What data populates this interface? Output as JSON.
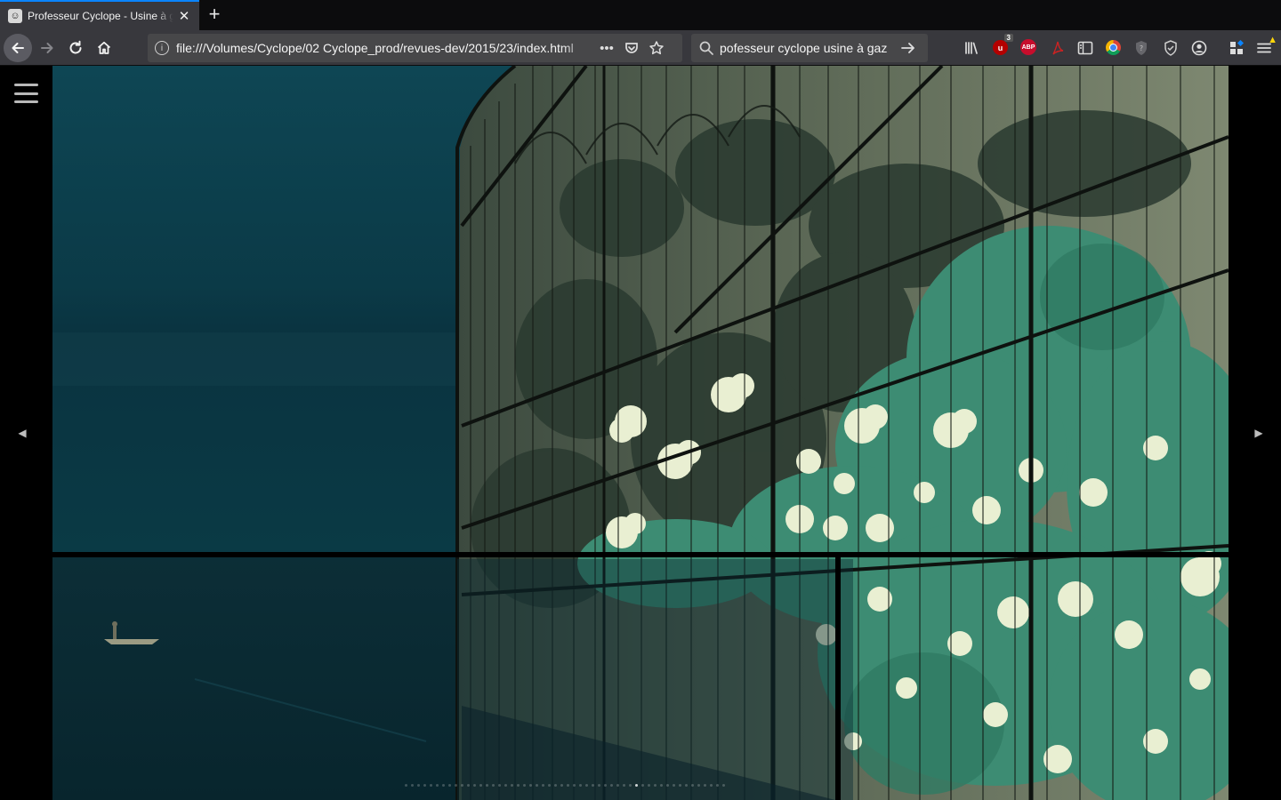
{
  "browser": {
    "tab": {
      "title": "Professeur Cyclope - Usine à gaz",
      "close_glyph": "✕",
      "favicon_icon": "cyclope-favicon"
    },
    "new_tab_glyph": "+",
    "url": "file:///Volumes/Cyclope/02 Cyclope_prod/revues-dev/2015/23/index.html",
    "search_value": "pofesseur cyclope usine à gaz",
    "toolbar": {
      "ublock_badge": "3",
      "abp_label": "ABP"
    },
    "colors": {
      "accent": "#0a84ff",
      "chrome": "#38383d",
      "field": "#474749"
    }
  },
  "page": {
    "menu_icon": "hamburger-menu-icon",
    "prev_icon": "chevron-left-icon",
    "next_icon": "chevron-right-icon",
    "artwork": {
      "description_icon": "greenhouse-illustration",
      "colors": {
        "sky": "#0c3f4c",
        "water": "#0a2a33",
        "glass": "#6f7a66",
        "foliage_dark": "#2b3a2f",
        "foliage_mid": "#3e8a72",
        "flowers": "#e9efd2"
      }
    },
    "pagination": {
      "total": 52,
      "active": 37
    }
  }
}
